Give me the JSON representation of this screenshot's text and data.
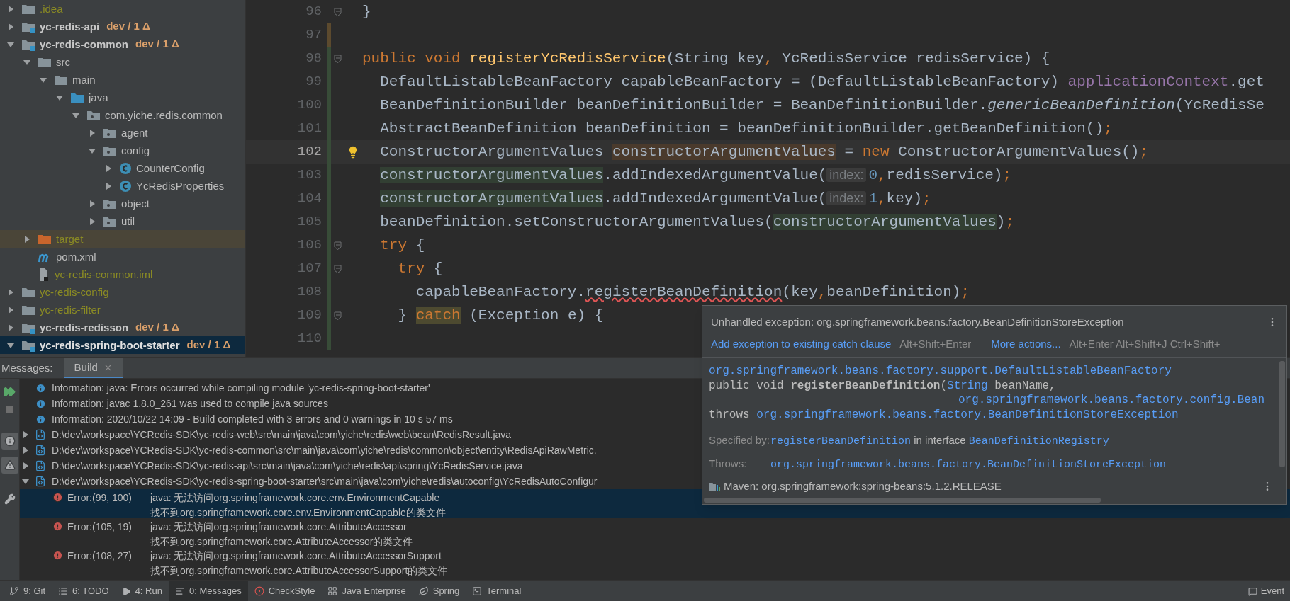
{
  "project_tree": [
    {
      "label": ".idea",
      "kind": "folder",
      "color": "#8b8b24",
      "expanded": false,
      "selected": false
    },
    {
      "label": "yc-redis-api",
      "kind": "module",
      "vcs": "dev / 1 Δ",
      "color": "#c8c8c8",
      "expanded": false,
      "selected": false
    },
    {
      "label": "yc-redis-common",
      "kind": "module",
      "vcs": "dev / 1 Δ",
      "color": "#c8c8c8",
      "expanded": true,
      "selected": false,
      "children": [
        {
          "label": "src",
          "kind": "folder",
          "color": "#bbbbbb",
          "expanded": true,
          "selected": false,
          "children": [
            {
              "label": "main",
              "kind": "folder",
              "color": "#bbbbbb",
              "expanded": true,
              "selected": false,
              "children": [
                {
                  "label": "java",
                  "kind": "source_folder",
                  "color": "#bbbbbb",
                  "expanded": true,
                  "selected": false,
                  "children": [
                    {
                      "label": "com.yiche.redis.common",
                      "kind": "package",
                      "color": "#bbbbbb",
                      "expanded": true,
                      "selected": false,
                      "children": [
                        {
                          "label": "agent",
                          "kind": "package",
                          "color": "#bbbbbb",
                          "expanded": false,
                          "selected": false
                        },
                        {
                          "label": "config",
                          "kind": "package",
                          "color": "#bbbbbb",
                          "expanded": true,
                          "selected": false,
                          "children": [
                            {
                              "label": "CounterConfig",
                              "kind": "class",
                              "color": "#bbbbbb",
                              "expanded": false,
                              "selected": false
                            },
                            {
                              "label": "YcRedisProperties",
                              "kind": "class",
                              "color": "#bbbbbb",
                              "expanded": false,
                              "selected": false
                            }
                          ]
                        },
                        {
                          "label": "object",
                          "kind": "package",
                          "color": "#bbbbbb",
                          "expanded": false,
                          "selected": false
                        },
                        {
                          "label": "util",
                          "kind": "package",
                          "color": "#bbbbbb",
                          "expanded": false,
                          "selected": false
                        }
                      ]
                    }
                  ]
                }
              ]
            }
          ]
        },
        {
          "label": "target",
          "kind": "excluded_folder",
          "color": "#8b8b24",
          "expanded": false,
          "selected": false
        },
        {
          "label": "pom.xml",
          "kind": "maven_file",
          "color": "#bbbbbb",
          "selected": false
        },
        {
          "label": "yc-redis-common.iml",
          "kind": "iml_file",
          "color": "#8b8b24",
          "selected": false
        }
      ]
    },
    {
      "label": "yc-redis-config",
      "kind": "folder",
      "color": "#8b8b24",
      "expanded": false,
      "selected": false
    },
    {
      "label": "yc-redis-filter",
      "kind": "folder",
      "color": "#8b8b24",
      "expanded": false,
      "selected": false
    },
    {
      "label": "yc-redis-redisson",
      "kind": "module",
      "vcs": "dev / 1 Δ",
      "color": "#c8c8c8",
      "expanded": false,
      "selected": false
    },
    {
      "label": "yc-redis-spring-boot-starter",
      "kind": "module",
      "vcs": "dev / 1 Δ",
      "expanded": true,
      "selected": true
    }
  ],
  "editor": {
    "lines": [
      {
        "number": "96",
        "current": false,
        "fold": true,
        "bulb": false,
        "tokens": [
          {
            "text": "}",
            "kind": "plain"
          }
        ]
      },
      {
        "number": "97",
        "current": false,
        "fold": false,
        "bulb": false,
        "color": "#5c4a2e"
      },
      {
        "number": "98",
        "current": false,
        "fold": true,
        "bulb": false,
        "color": "#384c38",
        "tokens": [
          {
            "text": "public void ",
            "kind": "kw"
          },
          {
            "text": "registerYcRedisService",
            "kind": "method"
          },
          {
            "text": "(String key",
            "kind": "plain"
          },
          {
            "text": ", ",
            "kind": "kw"
          },
          {
            "text": "YcRedisService redisService) {",
            "kind": "plain"
          }
        ]
      },
      {
        "number": "99",
        "current": false,
        "fold": false,
        "bulb": false,
        "color": "#384c38",
        "tokens": [
          {
            "text": "  DefaultListableBeanFactory capableBeanFactory = (DefaultListableBeanFactory) ",
            "kind": "plain"
          },
          {
            "text": "applicationContext",
            "kind": "field"
          },
          {
            "text": ".get",
            "kind": "plain"
          }
        ]
      },
      {
        "number": "100",
        "current": false,
        "fold": false,
        "bulb": false,
        "color": "#384c38",
        "tokens": [
          {
            "text": "  BeanDefinitionBuilder beanDefinitionBuilder = BeanDefinitionBuilder.",
            "kind": "plain"
          },
          {
            "text": "genericBeanDefinition",
            "kind": "static"
          },
          {
            "text": "(YcRedisSe",
            "kind": "plain"
          }
        ]
      },
      {
        "number": "101",
        "current": false,
        "fold": false,
        "bulb": false,
        "color": "#384c38",
        "tokens": [
          {
            "text": "  AbstractBeanDefinition beanDefinition = beanDefinitionBuilder.getBeanDefinition()",
            "kind": "plain"
          },
          {
            "text": ";",
            "kind": "kw"
          }
        ]
      },
      {
        "number": "102",
        "current": true,
        "fold": false,
        "bulb": true,
        "color": "#384c38",
        "tokens": [
          {
            "text": "  ConstructorArgumentValues ",
            "kind": "plain"
          },
          {
            "text": "constructorArgumentValues",
            "kind": "write_usage"
          },
          {
            "text": " = ",
            "kind": "plain"
          },
          {
            "text": "new ",
            "kind": "kw"
          },
          {
            "text": "ConstructorArgumentValues()",
            "kind": "plain"
          },
          {
            "text": ";",
            "kind": "kw"
          }
        ]
      },
      {
        "number": "103",
        "current": false,
        "fold": false,
        "bulb": false,
        "color": "#384c38",
        "tokens": [
          {
            "text": "  constructorArgumentValues",
            "kind": "read_usage"
          },
          {
            "text": ".addIndexedArgumentValue(",
            "kind": "plain"
          },
          {
            "text": "index:",
            "kind": "hint"
          },
          {
            "text": "0",
            "kind": "number"
          },
          {
            "text": ",",
            "kind": "kw"
          },
          {
            "text": "redisService)",
            "kind": "plain"
          },
          {
            "text": ";",
            "kind": "kw"
          }
        ]
      },
      {
        "number": "104",
        "current": false,
        "fold": false,
        "bulb": false,
        "color": "#384c38",
        "tokens": [
          {
            "text": "  constructorArgumentValues",
            "kind": "read_usage"
          },
          {
            "text": ".addIndexedArgumentValue(",
            "kind": "plain"
          },
          {
            "text": "index:",
            "kind": "hint"
          },
          {
            "text": "1",
            "kind": "number"
          },
          {
            "text": ",",
            "kind": "kw"
          },
          {
            "text": "key)",
            "kind": "plain"
          },
          {
            "text": ";",
            "kind": "kw"
          }
        ]
      },
      {
        "number": "105",
        "current": false,
        "fold": false,
        "bulb": false,
        "color": "#384c38",
        "tokens": [
          {
            "text": "  beanDefinition.setConstructorArgumentValues(",
            "kind": "plain"
          },
          {
            "text": "constructorArgumentValues",
            "kind": "read_usage"
          },
          {
            "text": ")",
            "kind": "plain"
          },
          {
            "text": ";",
            "kind": "kw"
          }
        ]
      },
      {
        "number": "106",
        "current": false,
        "fold": true,
        "bulb": false,
        "color": "#384c38",
        "tokens": [
          {
            "text": "  try",
            "kind": "kw"
          },
          {
            "text": " {",
            "kind": "plain"
          }
        ]
      },
      {
        "number": "107",
        "current": false,
        "fold": true,
        "bulb": false,
        "color": "#384c38",
        "tokens": [
          {
            "text": "    try",
            "kind": "kw"
          },
          {
            "text": " {",
            "kind": "plain"
          }
        ]
      },
      {
        "number": "108",
        "current": false,
        "fold": false,
        "bulb": false,
        "color": "#384c38",
        "tokens": [
          {
            "text": "      capableBeanFactory.",
            "kind": "plain"
          },
          {
            "text": "registerBeanDefinition",
            "kind": "error"
          },
          {
            "text": "(key",
            "kind": "plain"
          },
          {
            "text": ",",
            "kind": "kw"
          },
          {
            "text": "beanDefinition)",
            "kind": "plain"
          },
          {
            "text": ";",
            "kind": "kw"
          }
        ]
      },
      {
        "number": "109",
        "current": false,
        "fold": true,
        "bulb": false,
        "color": "#384c38",
        "tokens": [
          {
            "text": "    } ",
            "kind": "plain"
          },
          {
            "text": "catch",
            "kind": "kw_mark"
          },
          {
            "text": " (Exception e) {",
            "kind": "plain"
          }
        ]
      },
      {
        "number": "110",
        "current": false,
        "fold": false,
        "bulb": false,
        "color": "#384c38"
      }
    ]
  },
  "popup": {
    "title": "Unhandled exception: org.springframework.beans.factory.BeanDefinitionStoreException",
    "actions": [
      {
        "label": "Add exception to existing catch clause",
        "shortcut": "Alt+Shift+Enter"
      },
      {
        "label": "More actions...",
        "shortcut": "Alt+Enter Alt+Shift+J Ctrl+Shift+"
      }
    ],
    "doc": [
      {
        "kind": "plain",
        "segments": [
          {
            "text": "org.springframework.beans.factory.support.DefaultListableBeanFactory",
            "kind": "link"
          }
        ]
      },
      {
        "kind": "plain",
        "segments": [
          {
            "text": "public void **registerBeanDefinition**(",
            "kind": "text"
          },
          {
            "text": "String",
            "kind": "link"
          },
          {
            "text": " beanName,",
            "kind": "text"
          }
        ]
      },
      {
        "kind": "continuation",
        "segments": [
          {
            "text": "org.springframework.beans.factory.config.Bean",
            "kind": "link"
          }
        ]
      },
      {
        "kind": "plain",
        "segments": [
          {
            "text": "throws ",
            "kind": "text"
          },
          {
            "text": "org.springframework.beans.factory.BeanDefinitionStoreException",
            "kind": "link"
          }
        ]
      }
    ],
    "details": [
      {
        "label": "Specified by:",
        "segments": [
          {
            "text": "registerBeanDefinition",
            "kind": "link"
          },
          {
            "text": " in interface ",
            "kind": "text"
          },
          {
            "text": "BeanDefinitionRegistry",
            "kind": "link"
          }
        ]
      },
      {
        "label": "Throws:",
        "segments": [
          {
            "text": "org.springframework.beans.factory.BeanDefinitionStoreException",
            "kind": "link"
          }
        ]
      }
    ],
    "library": "Maven: org.springframework:spring-beans:5.1.2.RELEASE"
  },
  "messages": {
    "title": "Messages:",
    "tabs": [
      {
        "label": "Build",
        "selected": true
      }
    ],
    "filters": [
      {
        "kind": "info",
        "on": true
      },
      {
        "kind": "warning",
        "on": true
      }
    ],
    "rows": [
      {
        "kind": "info",
        "text": "Information: java: Errors occurred while compiling module 'yc-redis-spring-boot-starter'",
        "selected": false
      },
      {
        "kind": "info",
        "text": "Information: javac 1.8.0_261 was used to compile java sources",
        "selected": false
      },
      {
        "kind": "info",
        "text": "Information: 2020/10/22 14:09 - Build completed with 3 errors and 0 warnings in 10 s 57 ms",
        "selected": false
      },
      {
        "kind": "file",
        "text": "D:\\dev\\workspace\\YCRedis-SDK\\yc-redis-web\\src\\main\\java\\com\\yiche\\redis\\web\\bean\\RedisResult.java",
        "expanded": false,
        "selected": false
      },
      {
        "kind": "file",
        "text": "D:\\dev\\workspace\\YCRedis-SDK\\yc-redis-common\\src\\main\\java\\com\\yiche\\redis\\common\\object\\entity\\RedisApiRawMetric.",
        "expanded": false,
        "selected": false
      },
      {
        "kind": "file",
        "text": "D:\\dev\\workspace\\YCRedis-SDK\\yc-redis-api\\src\\main\\java\\com\\yiche\\redis\\api\\spring\\YcRedisService.java",
        "expanded": false,
        "selected": false
      },
      {
        "kind": "file",
        "text": "D:\\dev\\workspace\\YCRedis-SDK\\yc-redis-spring-boot-starter\\src\\main\\java\\com\\yiche\\redis\\autoconfig\\YcRedisAutoConfigur",
        "expanded": true,
        "selected": false
      },
      {
        "kind": "error",
        "location": "Error:(99, 100)",
        "message": "java: 无法访问org.springframework.core.env.EnvironmentCapable",
        "detail": "找不到org.springframework.core.env.EnvironmentCapable的类文件",
        "selected": true
      },
      {
        "kind": "error",
        "location": "Error:(105, 19)",
        "message": "java: 无法访问org.springframework.core.AttributeAccessor",
        "detail": "找不到org.springframework.core.AttributeAccessor的类文件",
        "selected": false
      },
      {
        "kind": "error",
        "location": "Error:(108, 27)",
        "message": "java: 无法访问org.springframework.core.AttributeAccessorSupport",
        "detail": "找不到org.springframework.core.AttributeAccessorSupport的类文件",
        "selected": false
      }
    ]
  },
  "status_bar": {
    "items": [
      {
        "kind": "git",
        "label": "9: Git",
        "selected": false
      },
      {
        "kind": "todo",
        "label": "6: TODO",
        "selected": false
      },
      {
        "kind": "run",
        "label": "4: Run",
        "selected": false
      },
      {
        "kind": "messages",
        "label": "0: Messages",
        "selected": true
      },
      {
        "kind": "checkstyle",
        "label": "CheckStyle",
        "selected": false
      },
      {
        "kind": "enterprise",
        "label": "Java Enterprise",
        "selected": false
      },
      {
        "kind": "spring",
        "label": "Spring",
        "selected": false
      },
      {
        "kind": "terminal",
        "label": "Terminal",
        "selected": false
      }
    ],
    "right": "Event"
  }
}
